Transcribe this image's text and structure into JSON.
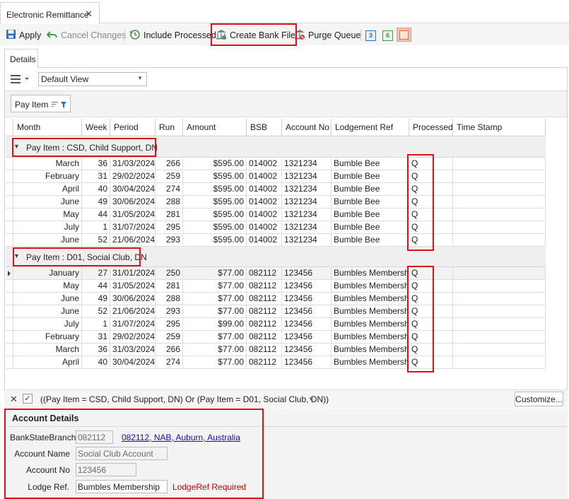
{
  "window": {
    "tab_title": "Electronic Remittance",
    "close_symbol": "✕"
  },
  "toolbar": {
    "apply": "Apply",
    "cancel_changes": "Cancel Changes",
    "include_processed": "Include Processed",
    "create_bank_file": "Create Bank File",
    "purge_queue": "Purge Queue",
    "layout_btn_1": "3",
    "layout_btn_2": "6"
  },
  "details_tab": "Details",
  "view_select": {
    "value": "Default View"
  },
  "group_chip": {
    "label": "Pay Item"
  },
  "columns": [
    "Month",
    "Week",
    "Period",
    "Run",
    "Amount",
    "BSB",
    "Account No",
    "Lodgement Ref",
    "Processed",
    "Time Stamp"
  ],
  "groups": [
    {
      "label": "Pay Item : CSD, Child Support, DN",
      "rows": [
        {
          "month": "March",
          "week": "36",
          "period": "31/03/2024",
          "run": "266",
          "amount": "$595.00",
          "bsb": "014002",
          "account_no": "1321234",
          "lodgement_ref": "Bumble Bee",
          "processed": "Q",
          "time_stamp": ""
        },
        {
          "month": "February",
          "week": "31",
          "period": "29/02/2024",
          "run": "259",
          "amount": "$595.00",
          "bsb": "014002",
          "account_no": "1321234",
          "lodgement_ref": "Bumble Bee",
          "processed": "Q",
          "time_stamp": ""
        },
        {
          "month": "April",
          "week": "40",
          "period": "30/04/2024",
          "run": "274",
          "amount": "$595.00",
          "bsb": "014002",
          "account_no": "1321234",
          "lodgement_ref": "Bumble Bee",
          "processed": "Q",
          "time_stamp": ""
        },
        {
          "month": "June",
          "week": "49",
          "period": "30/06/2024",
          "run": "288",
          "amount": "$595.00",
          "bsb": "014002",
          "account_no": "1321234",
          "lodgement_ref": "Bumble Bee",
          "processed": "Q",
          "time_stamp": ""
        },
        {
          "month": "May",
          "week": "44",
          "period": "31/05/2024",
          "run": "281",
          "amount": "$595.00",
          "bsb": "014002",
          "account_no": "1321234",
          "lodgement_ref": "Bumble Bee",
          "processed": "Q",
          "time_stamp": ""
        },
        {
          "month": "July",
          "week": "1",
          "period": "31/07/2024",
          "run": "295",
          "amount": "$595.00",
          "bsb": "014002",
          "account_no": "1321234",
          "lodgement_ref": "Bumble Bee",
          "processed": "Q",
          "time_stamp": ""
        },
        {
          "month": "June",
          "week": "52",
          "period": "21/06/2024",
          "run": "293",
          "amount": "$595.00",
          "bsb": "014002",
          "account_no": "1321234",
          "lodgement_ref": "Bumble Bee",
          "processed": "Q",
          "time_stamp": ""
        }
      ]
    },
    {
      "label": "Pay Item : D01, Social Club, DN",
      "rows": [
        {
          "month": "January",
          "week": "27",
          "period": "31/01/2024",
          "run": "250",
          "amount": "$77.00",
          "bsb": "082112",
          "account_no": "123456",
          "lodgement_ref": "Bumbles Membership",
          "processed": "Q",
          "time_stamp": "",
          "selected": true
        },
        {
          "month": "May",
          "week": "44",
          "period": "31/05/2024",
          "run": "281",
          "amount": "$77.00",
          "bsb": "082112",
          "account_no": "123456",
          "lodgement_ref": "Bumbles Membership",
          "processed": "Q",
          "time_stamp": ""
        },
        {
          "month": "June",
          "week": "49",
          "period": "30/06/2024",
          "run": "288",
          "amount": "$77.00",
          "bsb": "082112",
          "account_no": "123456",
          "lodgement_ref": "Bumbles Membership",
          "processed": "Q",
          "time_stamp": ""
        },
        {
          "month": "June",
          "week": "52",
          "period": "21/06/2024",
          "run": "293",
          "amount": "$77.00",
          "bsb": "082112",
          "account_no": "123456",
          "lodgement_ref": "Bumbles Membership",
          "processed": "Q",
          "time_stamp": ""
        },
        {
          "month": "July",
          "week": "1",
          "period": "31/07/2024",
          "run": "295",
          "amount": "$99.00",
          "bsb": "082112",
          "account_no": "123456",
          "lodgement_ref": "Bumbles Membership",
          "processed": "Q",
          "time_stamp": ""
        },
        {
          "month": "February",
          "week": "31",
          "period": "29/02/2024",
          "run": "259",
          "amount": "$77.00",
          "bsb": "082112",
          "account_no": "123456",
          "lodgement_ref": "Bumbles Membership",
          "processed": "Q",
          "time_stamp": ""
        },
        {
          "month": "March",
          "week": "36",
          "period": "31/03/2024",
          "run": "266",
          "amount": "$77.00",
          "bsb": "082112",
          "account_no": "123456",
          "lodgement_ref": "Bumbles Membership",
          "processed": "Q",
          "time_stamp": ""
        },
        {
          "month": "April",
          "week": "40",
          "period": "30/04/2024",
          "run": "274",
          "amount": "$77.00",
          "bsb": "082112",
          "account_no": "123456",
          "lodgement_ref": "Bumbles Membership",
          "processed": "Q",
          "time_stamp": ""
        }
      ]
    }
  ],
  "filter_bar": {
    "expression": "((Pay Item = CSD, Child Support, DN) Or (Pay Item = D01, Social Club, DN))",
    "customize": "Customize..."
  },
  "account_details": {
    "title": "Account Details",
    "bsb_label": "BankStateBranch",
    "bsb_value": "082112",
    "bsb_link": "082112, NAB, Auburn, Australia",
    "name_label": "Account Name",
    "name_value": "Social Club Account",
    "number_label": "Account No",
    "number_value": "123456",
    "lodge_label": "Lodge Ref.",
    "lodge_value": "Bumbles Membership",
    "lodge_error": "LodgeRef Required"
  },
  "colors": {
    "highlight_red": "#e0101a",
    "link_blue": "#1a0dab",
    "error_red": "#cc0000"
  }
}
